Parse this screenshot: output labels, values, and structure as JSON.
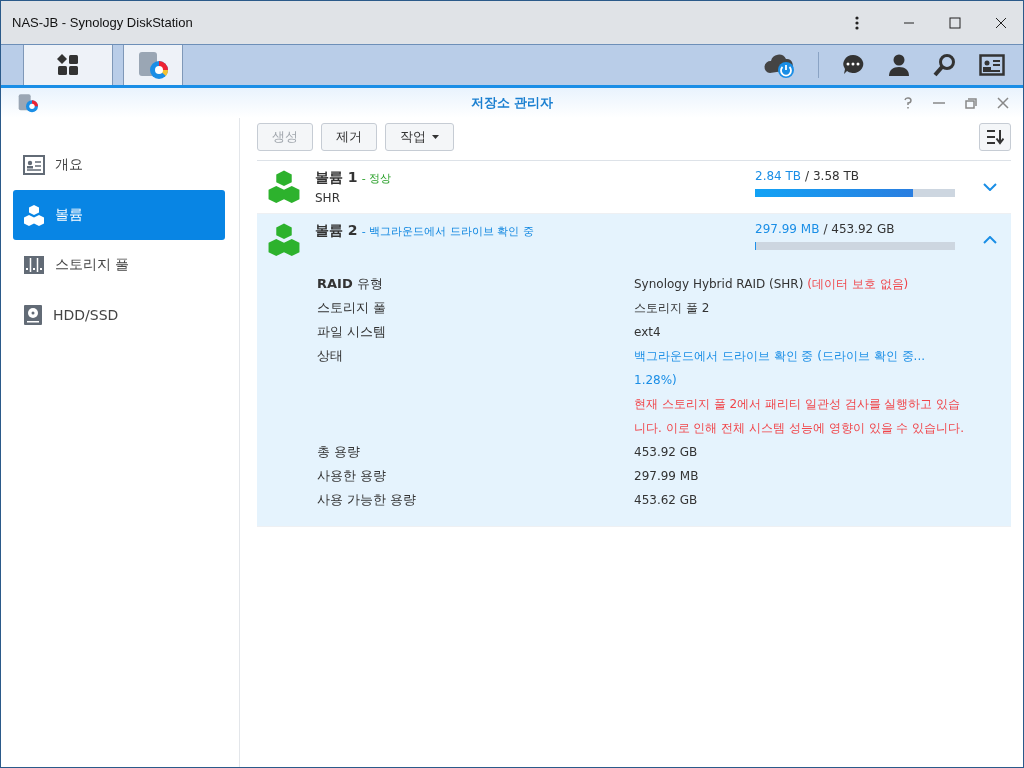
{
  "window": {
    "title": "NAS-JB - Synology DiskStation"
  },
  "app": {
    "title": "저장소 관리자"
  },
  "sidebar": {
    "items": [
      {
        "label": "개요",
        "kind": "overview",
        "selected": false
      },
      {
        "label": "볼륨",
        "kind": "volume",
        "selected": true
      },
      {
        "label": "스토리지 풀",
        "kind": "pool",
        "selected": false
      },
      {
        "label": "HDD/SSD",
        "kind": "disk",
        "selected": false
      }
    ]
  },
  "toolbar": {
    "buttons": [
      {
        "label": "생성",
        "disabled": true,
        "kind": "plain"
      },
      {
        "label": "제거",
        "disabled": false,
        "kind": "plain"
      },
      {
        "label": "작업",
        "disabled": false,
        "kind": "menu"
      }
    ]
  },
  "volumes": [
    {
      "name": "볼륨 1",
      "status": "- 정상",
      "kind": "normal",
      "subtitle": "SHR",
      "used": "2.84 TB",
      "total": "/ 3.58 TB",
      "level": 0.79,
      "expanded": false
    },
    {
      "name": "볼륨 2",
      "status": "- 백그라운드에서 드라이브 확인 중",
      "kind": "checking",
      "used": "297.99 MB",
      "total": "/ 453.92 GB",
      "level": 0.003,
      "expanded": true,
      "details": [
        {
          "label": "**RAID** 유형",
          "value": "Synology Hybrid RAID (SHR)",
          "kind": "plain",
          "note": "(데이터 보호 없음)"
        },
        {
          "label": "스토리지 풀",
          "value": "스토리지 풀 2",
          "kind": "plain"
        },
        {
          "label": "파일 시스템",
          "value": "ext4",
          "kind": "plain"
        },
        {
          "label": "상태",
          "value": "백그라운드에서 드라이브 확인 중 (드라이브 확인 중... 1.28%)",
          "kind": "info",
          "warning": "현재 스토리지 풀 2에서 패리티 일관성 검사를 실행하고 있습니다. 이로 인해 전체 시스템 성능에 영향이 있을 수 있습니다."
        },
        {
          "label": "총 용량",
          "value": "453.92 GB",
          "kind": "plain"
        },
        {
          "label": "사용한 용량",
          "value": "297.99 MB",
          "kind": "plain"
        },
        {
          "label": "사용 가능한 용량",
          "value": "453.62 GB",
          "kind": "plain"
        }
      ]
    }
  ]
}
